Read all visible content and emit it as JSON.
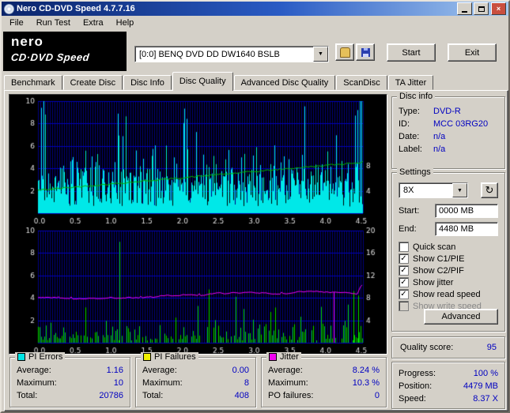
{
  "window": {
    "title": "Nero CD-DVD Speed 4.7.7.16"
  },
  "menu": {
    "items": [
      "File",
      "Run Test",
      "Extra",
      "Help"
    ]
  },
  "logo": {
    "brand": "nero",
    "product": "CD·DVD Speed"
  },
  "toolbar": {
    "drive_text": "[0:0]   BENQ DVD DD DW1640 BSLB",
    "start_label": "Start",
    "exit_label": "Exit"
  },
  "tabs": {
    "items": [
      "Benchmark",
      "Create Disc",
      "Disc Info",
      "Disc Quality",
      "Advanced Disc Quality",
      "ScanDisc",
      "TA Jitter"
    ],
    "active": "Disc Quality"
  },
  "disc_info": {
    "title": "Disc info",
    "rows": [
      {
        "label": "Type:",
        "value": "DVD-R"
      },
      {
        "label": "ID:",
        "value": "MCC 03RG20"
      },
      {
        "label": "Date:",
        "value": "n/a"
      },
      {
        "label": "Label:",
        "value": "n/a"
      }
    ]
  },
  "settings": {
    "title": "Settings",
    "speed_value": "8X",
    "start_label": "Start:",
    "start_value": "0000 MB",
    "end_label": "End:",
    "end_value": "4480 MB",
    "checkboxes": [
      {
        "label": "Quick scan",
        "checked": false,
        "enabled": true
      },
      {
        "label": "Show C1/PIE",
        "checked": true,
        "enabled": true
      },
      {
        "label": "Show C2/PIF",
        "checked": true,
        "enabled": true
      },
      {
        "label": "Show jitter",
        "checked": true,
        "enabled": true
      },
      {
        "label": "Show read speed",
        "checked": true,
        "enabled": true
      },
      {
        "label": "Show write speed",
        "checked": false,
        "enabled": false
      }
    ],
    "advanced_label": "Advanced"
  },
  "quality": {
    "label": "Quality score:",
    "value": "95"
  },
  "progress": {
    "rows": [
      {
        "label": "Progress:",
        "value": "100 %"
      },
      {
        "label": "Position:",
        "value": "4479 MB"
      },
      {
        "label": "Speed:",
        "value": "8.37 X"
      }
    ]
  },
  "stats": [
    {
      "title": "PI Errors",
      "swatch": "#00e6e6",
      "rows": [
        {
          "label": "Average:",
          "value": "1.16"
        },
        {
          "label": "Maximum:",
          "value": "10"
        },
        {
          "label": "Total:",
          "value": "20786"
        }
      ]
    },
    {
      "title": "PI Failures",
      "swatch": "#f0f000",
      "rows": [
        {
          "label": "Average:",
          "value": "0.00"
        },
        {
          "label": "Maximum:",
          "value": "8"
        },
        {
          "label": "Total:",
          "value": "408"
        }
      ]
    },
    {
      "title": "Jitter",
      "swatch": "#f000f0",
      "rows": [
        {
          "label": "Average:",
          "value": "8.24 %"
        },
        {
          "label": "Maximum:",
          "value": "10.3 %"
        },
        {
          "label": "PO failures:",
          "value": "0"
        }
      ]
    }
  ],
  "chart_data": [
    {
      "type": "bar",
      "name": "pi-errors-vs-position",
      "x_unit": "GB",
      "x_ticks": [
        "0.0",
        "0.5",
        "1.0",
        "1.5",
        "2.0",
        "2.5",
        "3.0",
        "3.5",
        "4.0",
        "4.5"
      ],
      "left_axis": {
        "min": 0,
        "max": 10,
        "ticks": [
          "10",
          "8",
          "6",
          "4",
          "2"
        ]
      },
      "right_axis": {
        "labels": [
          {
            "text": "8",
            "frac": 0.42
          },
          {
            "text": "4",
            "frac": 0.195
          }
        ]
      },
      "series": [
        {
          "name": "PI Errors",
          "style": "bars",
          "color": "#00e8e8",
          "average": 1.16,
          "maximum": 10,
          "total": 20786,
          "seed": 1337,
          "forced": [
            {
              "frac": 0.01,
              "v": 9.4
            },
            {
              "frac": 0.016,
              "v": 10
            },
            {
              "frac": 0.022,
              "v": 8.8
            },
            {
              "frac": 0.985,
              "v": 9.2
            },
            {
              "frac": 0.992,
              "v": 10
            },
            {
              "frac": 0.998,
              "v": 10
            }
          ]
        },
        {
          "name": "Read speed",
          "style": "line",
          "color": "#00b400",
          "start_speed_x": 3.4,
          "end_speed_x": 8.37,
          "start_frac": 0.205,
          "end_frac": 0.455,
          "seed": 42
        }
      ]
    },
    {
      "type": "bar",
      "name": "pi-failures-and-jitter-vs-position",
      "x_unit": "GB",
      "x_ticks": [
        "0.0",
        "0.5",
        "1.0",
        "1.5",
        "2.0",
        "2.5",
        "3.0",
        "3.5",
        "4.0",
        "4.5"
      ],
      "left_axis": {
        "min": 0,
        "max": 10,
        "ticks": [
          "10",
          "8",
          "6",
          "4",
          "2"
        ]
      },
      "right_axis": {
        "min": 0,
        "max": 20,
        "labels": [
          {
            "text": "20",
            "frac": 1.0
          },
          {
            "text": "16",
            "frac": 0.8
          },
          {
            "text": "12",
            "frac": 0.6
          },
          {
            "text": "8",
            "frac": 0.4
          },
          {
            "text": "4",
            "frac": 0.2
          }
        ]
      },
      "series": [
        {
          "name": "PI Failures",
          "style": "bars",
          "color": "#00d800",
          "average": 0.0,
          "maximum": 8,
          "total": 408,
          "seed": 2024,
          "forced": [
            {
              "frac": 0.251,
              "v": 9.0
            },
            {
              "frac": 0.873,
              "v": 3.2
            },
            {
              "frac": 0.955,
              "v": 3.4
            },
            {
              "frac": 0.972,
              "v": 4.6
            },
            {
              "frac": 0.988,
              "v": 4.2
            }
          ]
        },
        {
          "name": "Jitter",
          "style": "line",
          "color": "#f000f0",
          "average_pct": 8.24,
          "maximum_pct": 10.3,
          "base_frac": 0.403,
          "slope_frac": 0.045,
          "seed": 77,
          "end_spike_fracs": [
            0.47,
            0.5,
            0.515
          ],
          "vertical_spikes": [
            {
              "frac": 0.912
            }
          ]
        }
      ]
    }
  ]
}
